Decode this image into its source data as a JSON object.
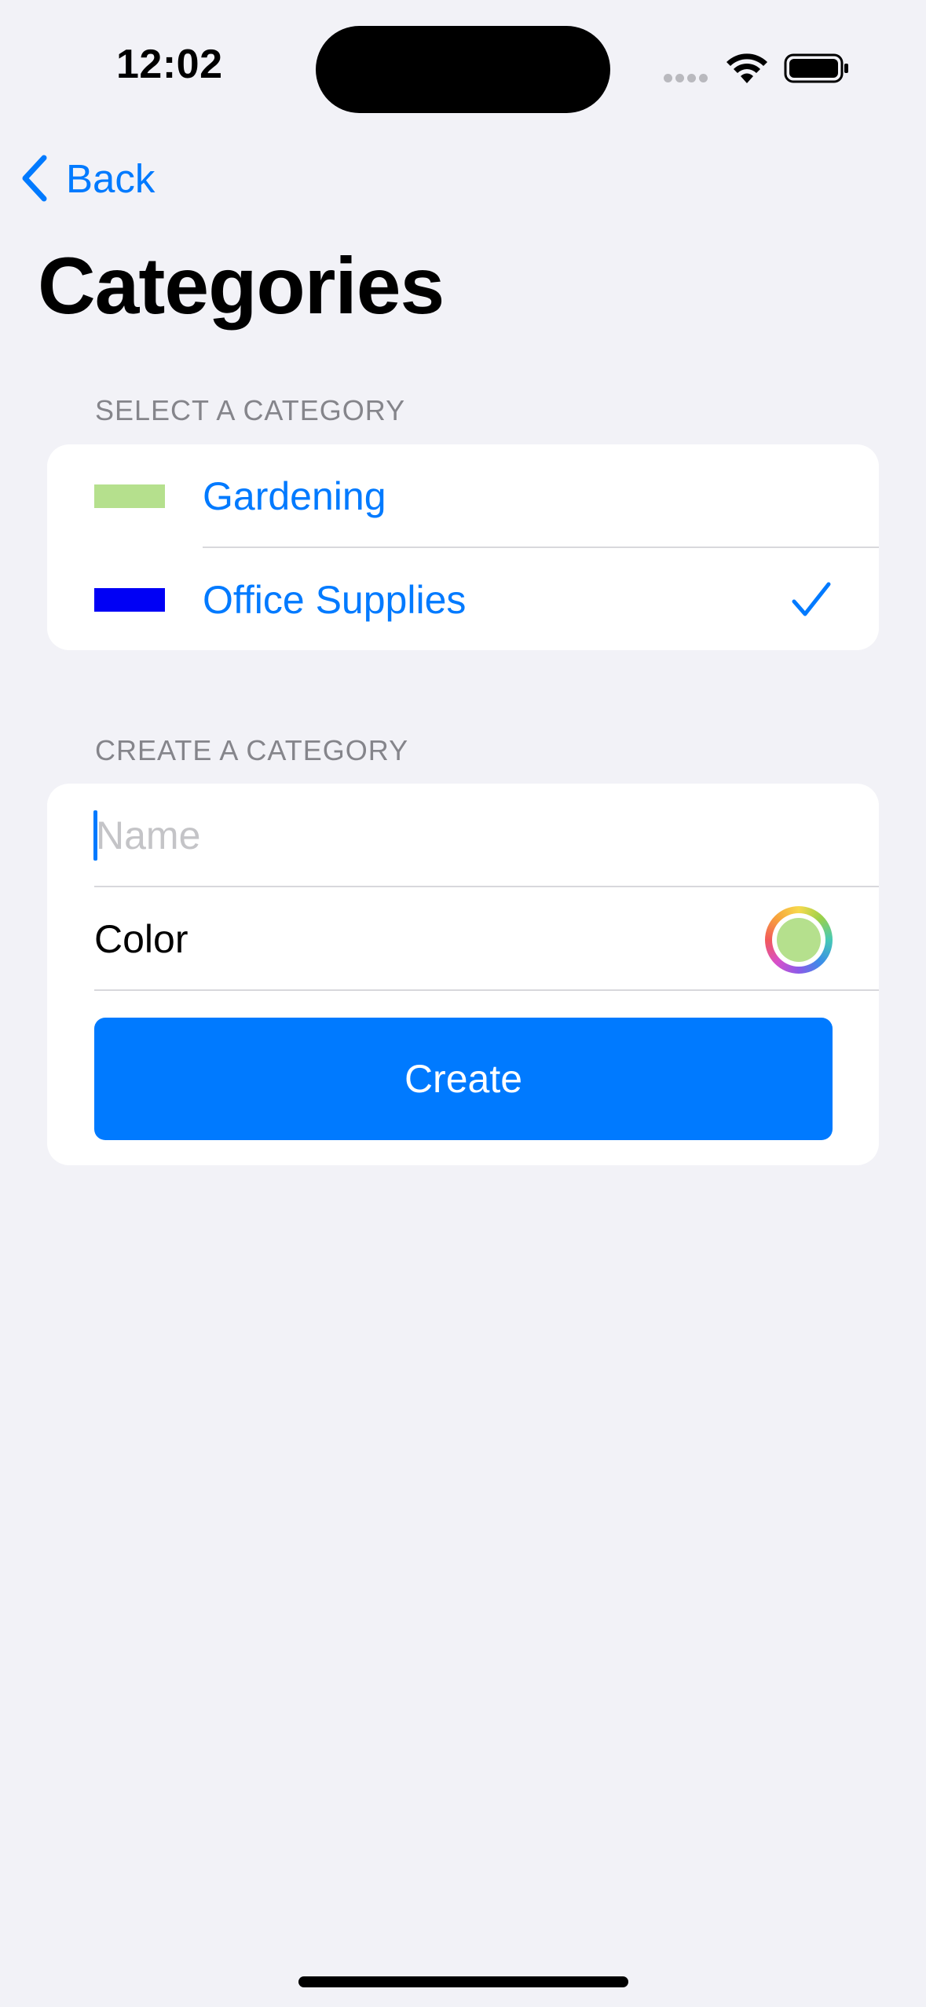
{
  "status_bar": {
    "time": "12:02"
  },
  "nav": {
    "back_label": "Back",
    "title": "Categories"
  },
  "select_section": {
    "header": "SELECT A CATEGORY",
    "items": [
      {
        "label": "Gardening",
        "color": "#b5e08d",
        "selected": false
      },
      {
        "label": "Office Supplies",
        "color": "#0000f5",
        "selected": true
      }
    ]
  },
  "create_section": {
    "header": "CREATE A CATEGORY",
    "name_placeholder": "Name",
    "name_value": "",
    "color_label": "Color",
    "selected_color": "#b5e08d",
    "create_label": "Create"
  },
  "theme": {
    "accent": "#007aff",
    "background": "#f2f2f7"
  }
}
